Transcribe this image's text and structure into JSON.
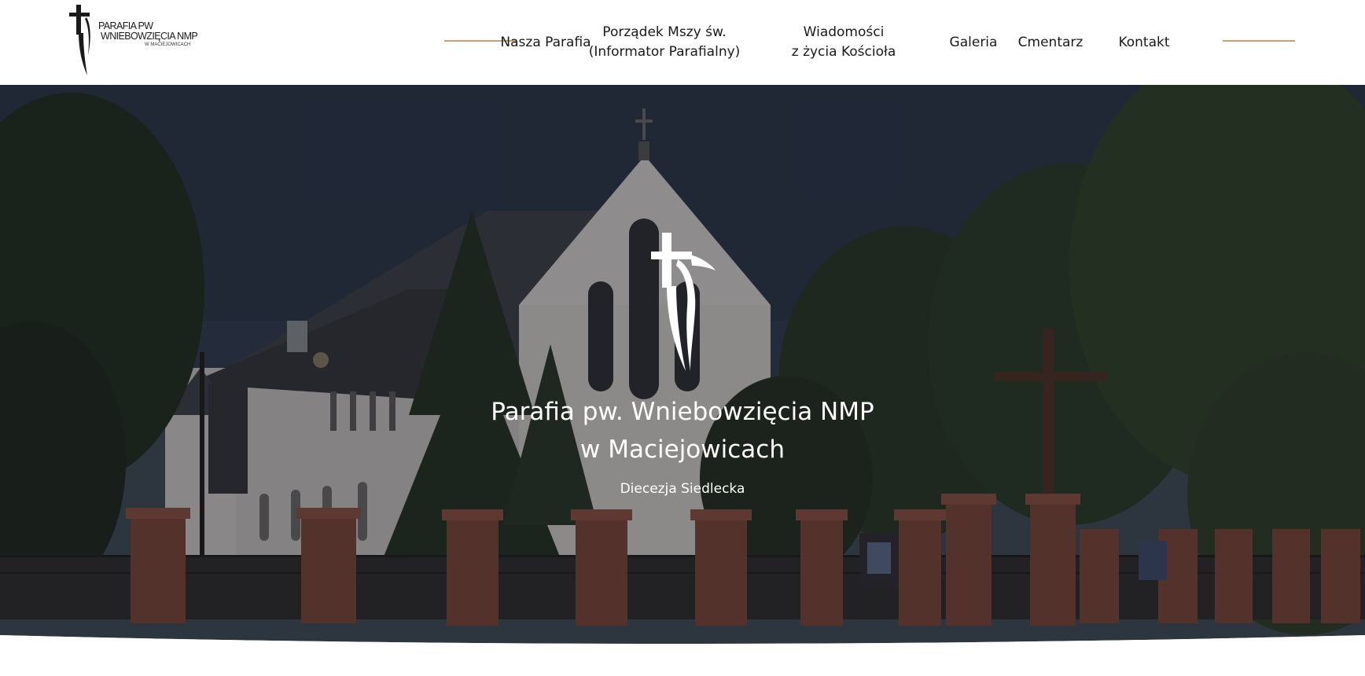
{
  "logo": {
    "line1": "PARAFIA PW",
    "line2": "WNIEBOWZIĘCIA NMP",
    "line3": "W MACIEJOWICACH",
    "icon": "cross-icon"
  },
  "nav": {
    "items": [
      {
        "label": "Nasza Parafia"
      },
      {
        "line1": "Porządek Mszy św.",
        "line2": "(Informator Parafialny)"
      },
      {
        "line1": "Wiadomości",
        "line2": "z życia Kościoła"
      },
      {
        "label": "Galeria"
      },
      {
        "label": "Cmentarz"
      },
      {
        "label": "Kontakt"
      }
    ],
    "accent_color": "#d29e74"
  },
  "hero": {
    "title_line1": "Parafia pw. Wniebowzięcia NMP",
    "title_line2": "w Maciejowicach",
    "subtitle": "Diecezja Siedlecka",
    "emblem_icon": "cross-icon",
    "image": "church-photo"
  },
  "colors": {
    "text_dark": "#1a1a1a",
    "hero_text": "#ffffff",
    "overlay": "#14161e"
  }
}
